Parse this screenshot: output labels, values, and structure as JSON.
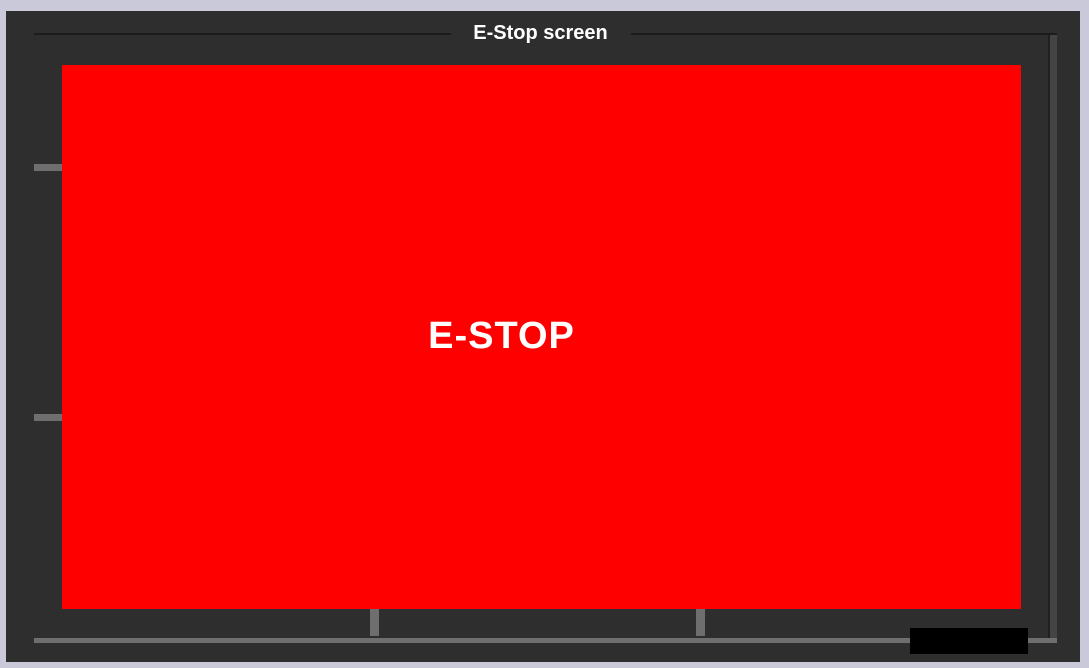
{
  "window": {
    "title": "E-Stop screen"
  },
  "panel": {
    "label": "E-STOP",
    "background_color": "#ff0000",
    "text_color": "#ffffff"
  },
  "colors": {
    "page_background": "#c9c9d9",
    "frame": "#2e2e2e",
    "bezel_accent": "#6e6e6e",
    "status_box": "#000000"
  }
}
